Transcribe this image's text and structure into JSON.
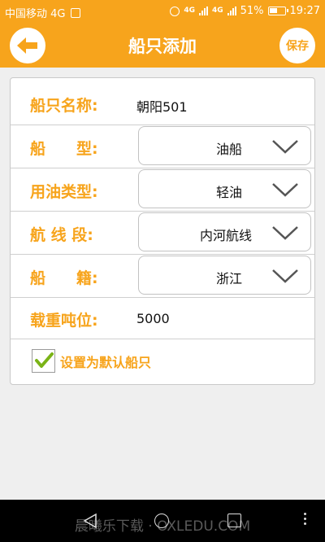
{
  "status_bar": {
    "carrier": "中国移动 4G",
    "network_1": "4G",
    "network_2": "4G",
    "battery": "51%",
    "time": "19:27"
  },
  "header": {
    "title": "船只添加",
    "save_label": "保存",
    "back_icon": "arrow-left-icon"
  },
  "form": {
    "name": {
      "label": "船只名称:",
      "value": "朝阳501"
    },
    "type": {
      "label": "船　　型:",
      "value": "油船"
    },
    "fuel_type": {
      "label": "用油类型:",
      "value": "轻油"
    },
    "route": {
      "label": "航  线  段:",
      "value": "内河航线"
    },
    "registry": {
      "label": "船　　籍:",
      "value": "浙江"
    },
    "tonnage": {
      "label": "载重吨位:",
      "value": "5000"
    },
    "default_checkbox": {
      "label": "设置为默认船只",
      "checked": true
    }
  },
  "nav_bar": {
    "watermark": "晨曦乐下载 ·  OXLEDU.COM"
  },
  "colors": {
    "accent": "#f7a41c",
    "check": "#7ab317"
  }
}
